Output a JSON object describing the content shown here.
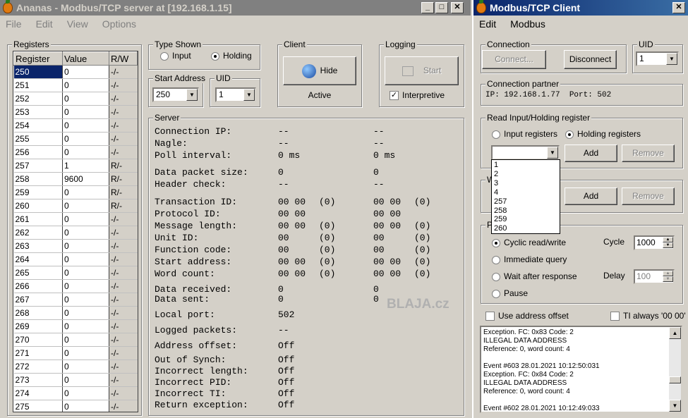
{
  "server_window": {
    "title": "Ananas - Modbus/TCP server at [192.168.1.15]",
    "menu": [
      "File",
      "Edit",
      "View",
      "Options"
    ],
    "registers": {
      "legend": "Registers",
      "headers": [
        "Register",
        "Value",
        "R/W"
      ],
      "rows": [
        [
          "250",
          "0",
          "-/-"
        ],
        [
          "251",
          "0",
          "-/-"
        ],
        [
          "252",
          "0",
          "-/-"
        ],
        [
          "253",
          "0",
          "-/-"
        ],
        [
          "254",
          "0",
          "-/-"
        ],
        [
          "255",
          "0",
          "-/-"
        ],
        [
          "256",
          "0",
          "-/-"
        ],
        [
          "257",
          "1",
          "R/-"
        ],
        [
          "258",
          "9600",
          "R/-"
        ],
        [
          "259",
          "0",
          "R/-"
        ],
        [
          "260",
          "0",
          "R/-"
        ],
        [
          "261",
          "0",
          "-/-"
        ],
        [
          "262",
          "0",
          "-/-"
        ],
        [
          "263",
          "0",
          "-/-"
        ],
        [
          "264",
          "0",
          "-/-"
        ],
        [
          "265",
          "0",
          "-/-"
        ],
        [
          "266",
          "0",
          "-/-"
        ],
        [
          "267",
          "0",
          "-/-"
        ],
        [
          "268",
          "0",
          "-/-"
        ],
        [
          "269",
          "0",
          "-/-"
        ],
        [
          "270",
          "0",
          "-/-"
        ],
        [
          "271",
          "0",
          "-/-"
        ],
        [
          "272",
          "0",
          "-/-"
        ],
        [
          "273",
          "0",
          "-/-"
        ],
        [
          "274",
          "0",
          "-/-"
        ],
        [
          "275",
          "0",
          "-/-"
        ]
      ]
    },
    "type_shown": {
      "legend": "Type Shown",
      "input_label": "Input",
      "holding_label": "Holding",
      "selected": "Holding"
    },
    "start_address": {
      "legend": "Start Address",
      "value": "250"
    },
    "uid": {
      "legend": "UID",
      "value": "1"
    },
    "client": {
      "legend": "Client",
      "hide_label": "Hide",
      "status": "Active"
    },
    "logging": {
      "legend": "Logging",
      "start_label": "Start",
      "interpretive_label": "Interpretive",
      "interpretive_checked": true
    },
    "server": {
      "legend": "Server",
      "rows": [
        [
          "Connection IP:",
          "--",
          "",
          "--",
          ""
        ],
        [
          "Nagle:",
          "--",
          "",
          "--",
          ""
        ],
        [
          "Poll interval:",
          "0 ms",
          "",
          "0 ms",
          ""
        ],
        [
          "Data packet size:",
          "0",
          "",
          "0",
          ""
        ],
        [
          "Header check:",
          "--",
          "",
          "--",
          ""
        ],
        [
          "Transaction ID:",
          "00 00",
          "(0)",
          "00 00",
          "(0)"
        ],
        [
          "Protocol ID:",
          "00 00",
          "",
          "00 00",
          ""
        ],
        [
          "Message length:",
          "00 00",
          "(0)",
          "00 00",
          "(0)"
        ],
        [
          "Unit ID:",
          "00",
          "(0)",
          "00",
          "(0)"
        ],
        [
          "Function code:",
          "00",
          "(0)",
          "00",
          "(0)"
        ],
        [
          "Start address:",
          "00 00",
          "(0)",
          "00 00",
          "(0)"
        ],
        [
          "Word count:",
          "00 00",
          "(0)",
          "00 00",
          "(0)"
        ],
        [
          "Data received:",
          "0",
          "",
          "0",
          ""
        ],
        [
          "Data sent:",
          "0",
          "",
          "0",
          ""
        ],
        [
          "Local port:",
          "502",
          "",
          "",
          ""
        ],
        [
          "Logged packets:",
          "--",
          "",
          "",
          ""
        ],
        [
          "Address offset:",
          "Off",
          "",
          "",
          ""
        ],
        [
          "Out of Synch:",
          "Off",
          "",
          "",
          ""
        ],
        [
          "Incorrect length:",
          "Off",
          "",
          "",
          ""
        ],
        [
          "Incorrect PID:",
          "Off",
          "",
          "",
          ""
        ],
        [
          "Incorrect TI:",
          "Off",
          "",
          "",
          ""
        ],
        [
          "Return exception:",
          "Off",
          "",
          "",
          ""
        ]
      ]
    },
    "watermark": "BLAJA.cz"
  },
  "client_window": {
    "title": "Modbus/TCP Client",
    "menu": [
      "Edit",
      "Modbus"
    ],
    "connection": {
      "legend": "Connection",
      "connect_label": "Connect...",
      "disconnect_label": "Disconnect"
    },
    "uid": {
      "legend": "UID",
      "value": "1"
    },
    "partner": {
      "legend": "Connection partner",
      "text": "IP: 192.168.1.77  Port: 502"
    },
    "read": {
      "legend": "Read Input/Holding register",
      "input_label": "Input registers",
      "holding_label": "Holding registers",
      "selected": "Holding registers",
      "add_label": "Add",
      "remove_label": "Remove",
      "dropdown_options": [
        "1",
        "2",
        "3",
        "4",
        "257",
        "258",
        "259",
        "260"
      ]
    },
    "write": {
      "legend_fragment": "W",
      "add_label": "Add",
      "remove_label": "Remove"
    },
    "poll": {
      "legend_fragment": "Po",
      "cyclic_label": "Cyclic read/write",
      "immediate_label": "Immediate query",
      "wait_label": "Wait after response",
      "pause_label": "Pause",
      "selected": "Cyclic read/write",
      "cycle_label": "Cycle",
      "cycle_value": "1000",
      "delay_label": "Delay",
      "delay_value": "100"
    },
    "use_offset_label": "Use address offset",
    "ti_label": "TI always '00 00'",
    "log_lines": [
      "Exception. FC: 0x83 Code: 2",
      "ILLEGAL DATA ADDRESS",
      "Reference: 0, word count: 4",
      "",
      "Event #603  28.01.2021 10:12:50:031",
      "Exception. FC: 0x84 Code: 2",
      "ILLEGAL DATA ADDRESS",
      "Reference: 0, word count: 4",
      "",
      "Event #602  28.01.2021 10:12:49:033"
    ]
  }
}
